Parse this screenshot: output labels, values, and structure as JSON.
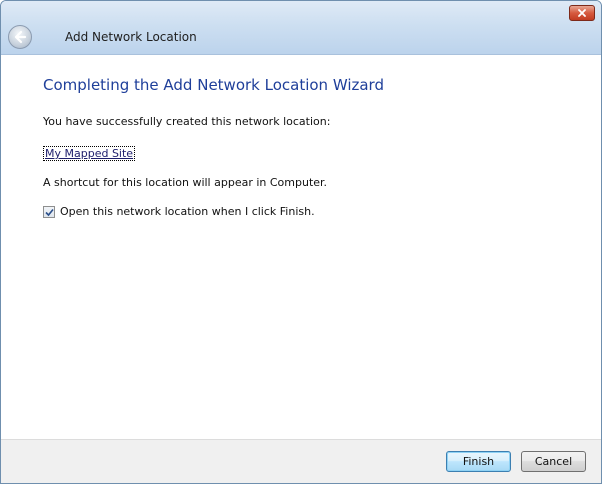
{
  "window": {
    "title": "Add Network Location"
  },
  "content": {
    "heading": "Completing the Add Network Location Wizard",
    "success_text": "You have successfully created this network location:",
    "location_link": "My Mapped Site",
    "shortcut_text": "A shortcut for this location will appear in Computer.",
    "open_checkbox": {
      "label": "Open this network location when I click Finish.",
      "checked": true
    }
  },
  "footer": {
    "finish_label": "Finish",
    "cancel_label": "Cancel"
  },
  "icons": {
    "back": "back-arrow-icon",
    "close": "close-icon",
    "check": "checkmark-icon"
  },
  "colors": {
    "heading": "#1f3f9a",
    "link": "#1d1d6b",
    "close_button": "#c13c22"
  }
}
